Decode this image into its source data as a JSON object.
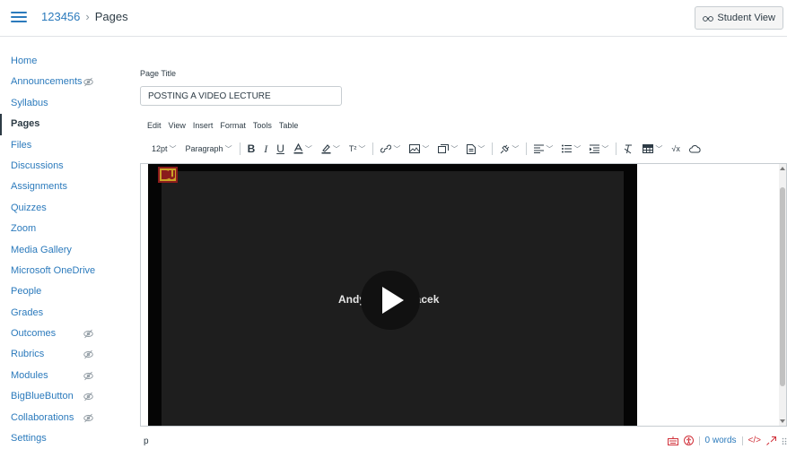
{
  "header": {
    "course": "123456",
    "separator": "›",
    "current_page": "Pages",
    "student_view_label": "Student View"
  },
  "sidebar": {
    "items": [
      {
        "label": "Home",
        "hidden": false,
        "active": false
      },
      {
        "label": "Announcements",
        "hidden": true,
        "active": false
      },
      {
        "label": "Syllabus",
        "hidden": false,
        "active": false
      },
      {
        "label": "Pages",
        "hidden": false,
        "active": true
      },
      {
        "label": "Files",
        "hidden": false,
        "active": false
      },
      {
        "label": "Discussions",
        "hidden": false,
        "active": false
      },
      {
        "label": "Assignments",
        "hidden": false,
        "active": false
      },
      {
        "label": "Quizzes",
        "hidden": false,
        "active": false
      },
      {
        "label": "Zoom",
        "hidden": false,
        "active": false
      },
      {
        "label": "Media Gallery",
        "hidden": false,
        "active": false
      },
      {
        "label": "Microsoft OneDrive",
        "hidden": false,
        "active": false
      },
      {
        "label": "People",
        "hidden": false,
        "active": false
      },
      {
        "label": "Grades",
        "hidden": false,
        "active": false
      },
      {
        "label": "Outcomes",
        "hidden": true,
        "active": false
      },
      {
        "label": "Rubrics",
        "hidden": true,
        "active": false
      },
      {
        "label": "Modules",
        "hidden": true,
        "active": false
      },
      {
        "label": "BigBlueButton",
        "hidden": true,
        "active": false
      },
      {
        "label": "Collaborations",
        "hidden": true,
        "active": false
      },
      {
        "label": "Settings",
        "hidden": false,
        "active": false
      }
    ]
  },
  "form": {
    "title_label": "Page Title",
    "title_value": "POSTING A VIDEO LECTURE"
  },
  "editor": {
    "menus": [
      "Edit",
      "View",
      "Insert",
      "Format",
      "Tools",
      "Table"
    ],
    "font_size": "12pt",
    "block_format": "Paragraph",
    "superscript_label": "T²",
    "math_label": "√x",
    "video": {
      "caption_left": "Andy",
      "caption_right": "racek"
    }
  },
  "statusbar": {
    "path": "p",
    "word_count": "0 words",
    "html_toggle": "</>"
  },
  "colors": {
    "link": "#2b7abc",
    "text": "#2d3b45",
    "border": "#c7cdd1",
    "danger": "#d1313a"
  }
}
